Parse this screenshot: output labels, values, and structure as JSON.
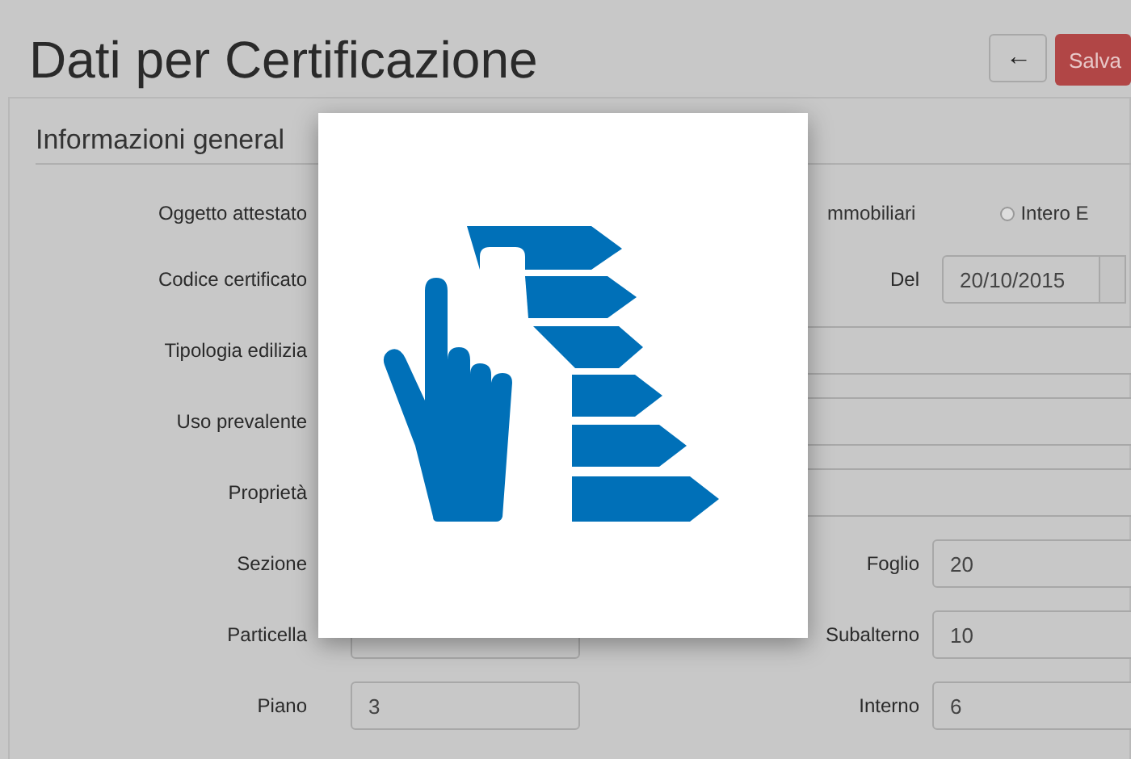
{
  "header": {
    "title": "Dati per Certificazione",
    "back_label": "←",
    "save_label": "Salva"
  },
  "section": {
    "title": "Informazioni general"
  },
  "rows": [
    {
      "kind": "radio",
      "label": "Oggetto attestato",
      "options": [
        {
          "label": "mmobiliari"
        },
        {
          "label": "Intero E",
          "selected": false
        }
      ]
    },
    {
      "kind": "covered_pair",
      "left": {
        "label": "Codice certificato"
      },
      "right": {
        "label": "Del",
        "value": "20/10/2015",
        "addon": true
      }
    },
    {
      "kind": "wide",
      "label": "Tipologia edilizia"
    },
    {
      "kind": "wide",
      "label": "Uso prevalente"
    },
    {
      "kind": "wide",
      "label": "Proprietà"
    },
    {
      "kind": "covered_pair",
      "left": {
        "label": "Sezione"
      },
      "right": {
        "label": "Foglio",
        "value": "20"
      }
    },
    {
      "kind": "pair",
      "left": {
        "label": "Particella"
      },
      "right": {
        "label": "Subalterno",
        "value": "10"
      }
    },
    {
      "kind": "pair",
      "left": {
        "label": "Piano",
        "value": "3"
      },
      "right": {
        "label": "Interno",
        "value": "6"
      }
    }
  ]
}
